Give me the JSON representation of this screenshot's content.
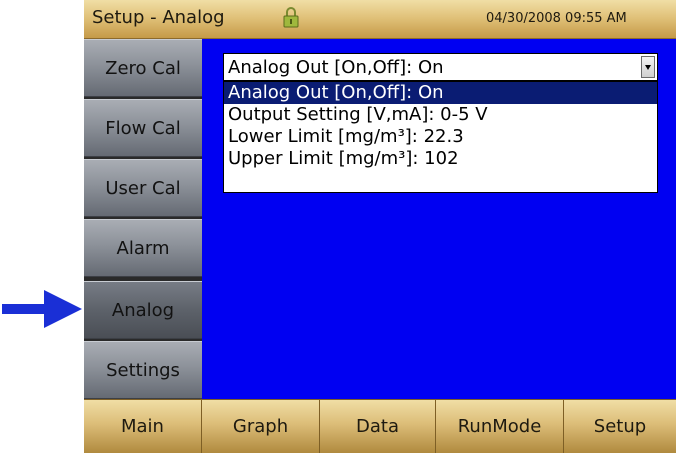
{
  "titlebar": {
    "title": "Setup - Analog",
    "lock_icon": "padlock-icon",
    "datetime": "04/30/2008 09:55 AM"
  },
  "pointer": {
    "icon": "right-arrow-icon",
    "color": "#1a2fd6"
  },
  "sidebar": {
    "items": [
      {
        "label": "Zero Cal"
      },
      {
        "label": "Flow Cal"
      },
      {
        "label": "User Cal"
      },
      {
        "label": "Alarm"
      },
      {
        "label": "Analog"
      },
      {
        "label": "Settings"
      }
    ],
    "active": "Analog"
  },
  "content": {
    "background": "#0000f2",
    "select": {
      "value": "Analog Out [On,Off]: On",
      "icon": "chevron-down-icon"
    },
    "options": [
      {
        "label": "Analog Out [On,Off]: On",
        "selected": true
      },
      {
        "label": "Output Setting [V,mA]: 0-5 V",
        "selected": false
      },
      {
        "label": "Lower Limit [mg/m³]: 22.3",
        "selected": false
      },
      {
        "label": "Upper Limit [mg/m³]: 102",
        "selected": false
      }
    ]
  },
  "tabbar": {
    "tabs": [
      {
        "label": "Main"
      },
      {
        "label": "Graph"
      },
      {
        "label": "Data"
      },
      {
        "label": "RunMode"
      },
      {
        "label": "Setup"
      }
    ]
  }
}
